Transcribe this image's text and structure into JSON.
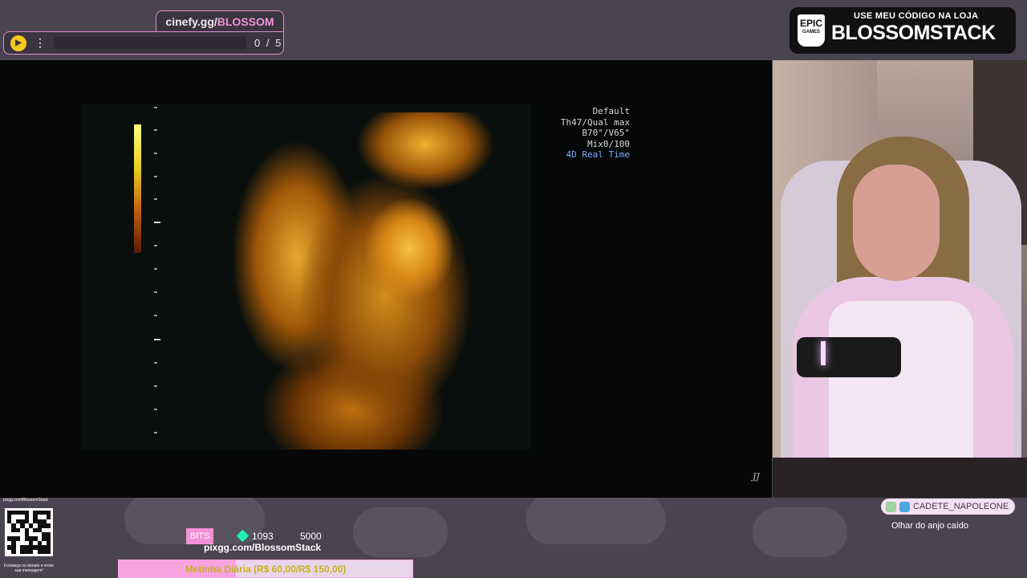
{
  "cinefy": {
    "url_prefix": "cinefy.gg/",
    "url_name": "BLOSSOM",
    "progress": "0 / 5",
    "menu_icon": "kebab-menu-icon",
    "logo_icon": "cinefy-logo-icon"
  },
  "sponsor": {
    "logo_line1": "EPIC",
    "logo_line2": "GAMES",
    "tagline": "USE MEU CÓDIGO NA LOJA",
    "code": "BLOSSOMSTACK"
  },
  "ultrasound": {
    "info": [
      "Default",
      "Th47/Qual max",
      "B70°/V65°",
      "Mix0/100"
    ],
    "mode": "4D Real Time",
    "mark": "JJ"
  },
  "qr": {
    "url": "pixgg.com/BlossomStack",
    "caption": "Fortaleça no donate e envie sua mensagem!"
  },
  "bits": {
    "label": "BITS",
    "current": "1093",
    "goal": "5000",
    "progress": 0.2186,
    "accent": "#f38fd4"
  },
  "pix": {
    "url": "pixgg.com/BlossomStack"
  },
  "meta": {
    "text": "Metinha Diária (R$ 60,00/R$ 150,00)",
    "progress": 0.4
  },
  "chat": {
    "username": "CADETE_NAPOLEONE",
    "message": "Olhar do anjo caído"
  }
}
